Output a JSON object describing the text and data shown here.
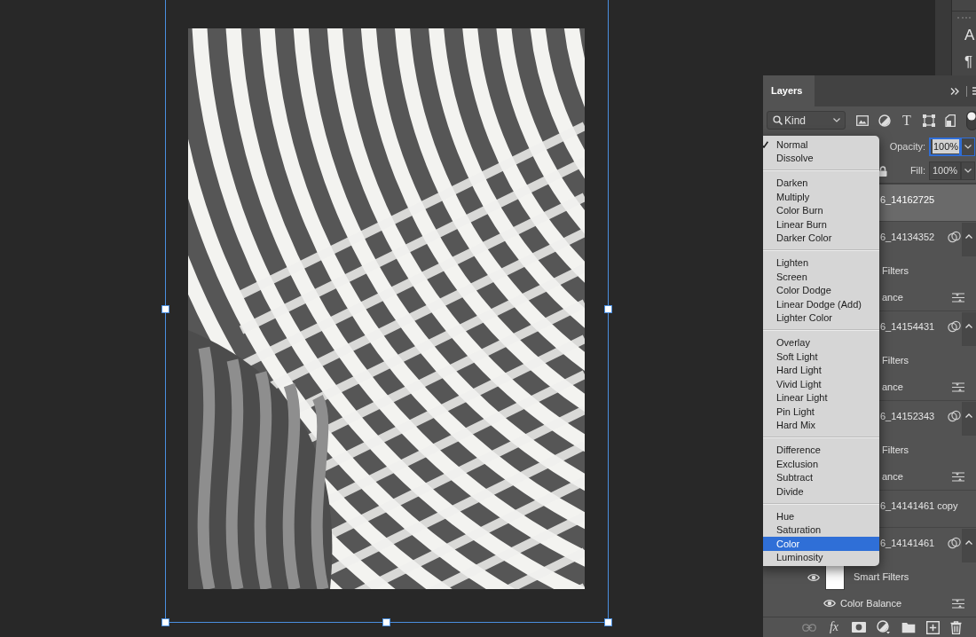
{
  "dock": {
    "buttons": [
      "A",
      "¶"
    ]
  },
  "layers_panel": {
    "tab": {
      "label": "Layers",
      "selected": true
    },
    "filter": {
      "value": "Kind",
      "type_glyph": "T",
      "toggle_on": true
    },
    "opacity": {
      "label": "Opacity:",
      "value": "100%",
      "focused": true
    },
    "fill": {
      "label": "Fill:",
      "value": "100%",
      "focused": false
    },
    "layers": [
      {
        "name": "6_14162725",
        "selected": true
      },
      {
        "name": "6_14134352",
        "selected": false,
        "filters": {
          "expanded": true,
          "items": [
            {
              "kind": "group",
              "name": "Filters"
            },
            {
              "kind": "effect",
              "name": "ance"
            }
          ]
        }
      },
      {
        "name": "6_14154431",
        "selected": false,
        "filters": {
          "expanded": true,
          "items": [
            {
              "kind": "group",
              "name": "Filters"
            },
            {
              "kind": "effect",
              "name": "ance"
            }
          ]
        }
      },
      {
        "name": "6_14152343",
        "selected": false,
        "filters": {
          "expanded": true,
          "items": [
            {
              "kind": "group",
              "name": "Filters"
            },
            {
              "kind": "effect",
              "name": "ance"
            }
          ]
        }
      },
      {
        "name": "6_14141461 copy",
        "selected": false
      },
      {
        "name": "6_14141461",
        "selected": false,
        "filters": {
          "expanded": true,
          "items": [
            {
              "kind": "group",
              "name": "Smart Filters"
            },
            {
              "kind": "effect",
              "name": "Color Balance"
            }
          ]
        }
      }
    ],
    "footer": {
      "fx_label": "fx"
    }
  },
  "blend_menu": {
    "groups": [
      {
        "items": [
          {
            "label": "Normal",
            "checked": true,
            "selected": false
          },
          {
            "label": "Dissolve",
            "checked": false,
            "selected": false
          }
        ]
      },
      {
        "items": [
          {
            "label": "Darken",
            "checked": false,
            "selected": false
          },
          {
            "label": "Multiply",
            "checked": false,
            "selected": false
          },
          {
            "label": "Color Burn",
            "checked": false,
            "selected": false
          },
          {
            "label": "Linear Burn",
            "checked": false,
            "selected": false
          },
          {
            "label": "Darker Color",
            "checked": false,
            "selected": false
          }
        ]
      },
      {
        "items": [
          {
            "label": "Lighten",
            "checked": false,
            "selected": false
          },
          {
            "label": "Screen",
            "checked": false,
            "selected": false
          },
          {
            "label": "Color Dodge",
            "checked": false,
            "selected": false
          },
          {
            "label": "Linear Dodge (Add)",
            "checked": false,
            "selected": false
          },
          {
            "label": "Lighter Color",
            "checked": false,
            "selected": false
          }
        ]
      },
      {
        "items": [
          {
            "label": "Overlay",
            "checked": false,
            "selected": false
          },
          {
            "label": "Soft Light",
            "checked": false,
            "selected": false
          },
          {
            "label": "Hard Light",
            "checked": false,
            "selected": false
          },
          {
            "label": "Vivid Light",
            "checked": false,
            "selected": false
          },
          {
            "label": "Linear Light",
            "checked": false,
            "selected": false
          },
          {
            "label": "Pin Light",
            "checked": false,
            "selected": false
          },
          {
            "label": "Hard Mix",
            "checked": false,
            "selected": false
          }
        ]
      },
      {
        "items": [
          {
            "label": "Difference",
            "checked": false,
            "selected": false
          },
          {
            "label": "Exclusion",
            "checked": false,
            "selected": false
          },
          {
            "label": "Subtract",
            "checked": false,
            "selected": false
          },
          {
            "label": "Divide",
            "checked": false,
            "selected": false
          }
        ]
      },
      {
        "items": [
          {
            "label": "Hue",
            "checked": false,
            "selected": false
          },
          {
            "label": "Saturation",
            "checked": false,
            "selected": false
          },
          {
            "label": "Color",
            "checked": false,
            "selected": true
          },
          {
            "label": "Luminosity",
            "checked": false,
            "selected": false
          }
        ]
      }
    ]
  }
}
